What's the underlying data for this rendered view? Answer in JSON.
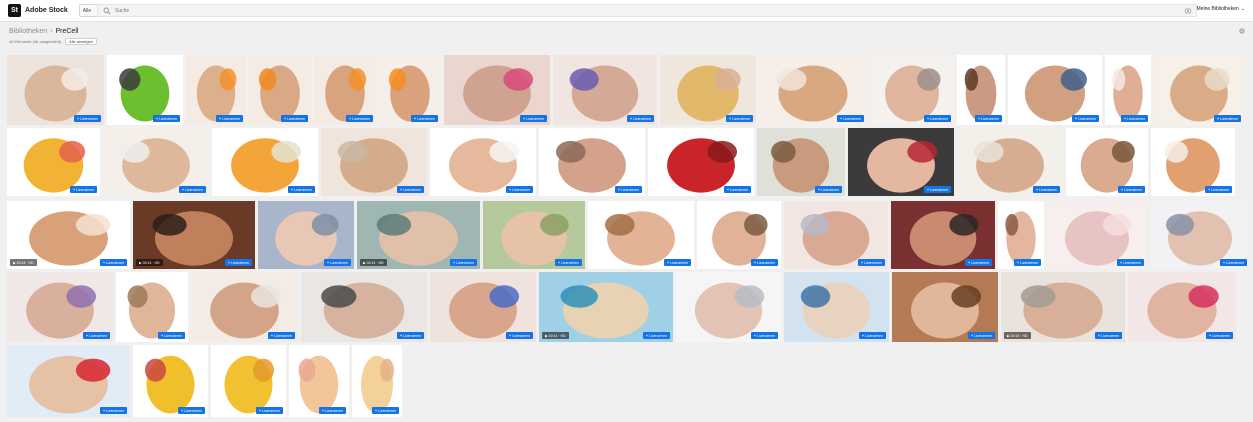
{
  "header": {
    "logo_mark": "St",
    "logo_text": "Adobe Stock",
    "category": "Alle",
    "search_placeholder": "Suche",
    "account_label": "Meine Bibliotheken"
  },
  "breadcrumb": {
    "library": "Bibliotheken",
    "separator": "›",
    "current": "PreCell"
  },
  "toolbar": {
    "count_label": "46 Elemente (46 ausgewählt)",
    "view_label": "Alle anzeigen"
  },
  "tile_button_label": "Lizenzieren",
  "video_badge": "▶ 00:14 · HD",
  "colors": {
    "accent": "#1473e6",
    "background": "#f0f0f0"
  },
  "tiles": [
    {
      "id": "hips-tape",
      "bg": "#ece4dc",
      "c1": "#d9b79a",
      "c2": "#f4ece6"
    },
    {
      "id": "apple-measure",
      "bg": "#ffffff",
      "c1": "#6cbf2f",
      "c2": "#3b3b3b"
    },
    {
      "id": "legs-orange",
      "bg": "#f3ebe4",
      "c1": "#dcb08d",
      "c2": "#f3902a"
    },
    {
      "id": "waist-orange",
      "bg": "#f3ebe4",
      "c1": "#d9a884",
      "c2": "#f08a22"
    },
    {
      "id": "hips-orange",
      "bg": "#f3ebe4",
      "c1": "#d8a47e",
      "c2": "#f29227"
    },
    {
      "id": "bikini-orange",
      "bg": "#f6efe9",
      "c1": "#d9a27c",
      "c2": "#f38d21"
    },
    {
      "id": "face-spa-gloves",
      "bg": "#ead5cf",
      "c1": "#cfa38f",
      "c2": "#d64a7a"
    },
    {
      "id": "face-device",
      "bg": "#f1e5e2",
      "c1": "#d4a995",
      "c2": "#6a5db0"
    },
    {
      "id": "gold-mask",
      "bg": "#efe7dd",
      "c1": "#e2b96a",
      "c2": "#d9b094"
    },
    {
      "id": "legs-shaving",
      "bg": "#f6eee8",
      "c1": "#d7a882",
      "c2": "#f1e5da"
    },
    {
      "id": "face-needle",
      "bg": "#f5f1ee",
      "c1": "#e0b59e",
      "c2": "#9a8f8a"
    },
    {
      "id": "woman-portrait",
      "bg": "#ffffff",
      "c1": "#cb9a82",
      "c2": "#5d3a25"
    },
    {
      "id": "jeans-waist",
      "bg": "#ffffff",
      "c1": "#d0a080",
      "c2": "#3f5f89"
    },
    {
      "id": "leg-raised",
      "bg": "#ffffff",
      "c1": "#dfae93",
      "c2": "#f4e8e4"
    },
    {
      "id": "legs-lying",
      "bg": "#f7f0e8",
      "c1": "#d9ab87",
      "c2": "#e9dbc8"
    },
    {
      "id": "cellulite-diagram",
      "bg": "#ffffff",
      "c1": "#f2b335",
      "c2": "#e3624a"
    },
    {
      "id": "legs-sheet",
      "bg": "#f5efe9",
      "c1": "#dfb89b",
      "c2": "#eeeeee"
    },
    {
      "id": "orange-measure",
      "bg": "#ffffff",
      "c1": "#f4a53a",
      "c2": "#e3e3d0"
    },
    {
      "id": "body-roller",
      "bg": "#efe5dc",
      "c1": "#d4ac8c",
      "c2": "#c8b7a2"
    },
    {
      "id": "women-row",
      "bg": "#ffffff",
      "c1": "#e6b89c",
      "c2": "#f4f4f4"
    },
    {
      "id": "face-laser",
      "bg": "#ffffff",
      "c1": "#d4a18a",
      "c2": "#8c6a56"
    },
    {
      "id": "red-apples",
      "bg": "#ffffff",
      "c1": "#c9242a",
      "c2": "#8b1a1a"
    },
    {
      "id": "aging-face",
      "bg": "#dfe0d8",
      "c1": "#c89a7e",
      "c2": "#7a5c3e"
    },
    {
      "id": "red-lips",
      "bg": "#3c3a3a",
      "c1": "#e4b7a0",
      "c2": "#b52834"
    },
    {
      "id": "spa-massage",
      "bg": "#f3efe9",
      "c1": "#d7ad92",
      "c2": "#e9e3d7"
    },
    {
      "id": "natural-beauty",
      "bg": "#ffffff",
      "c1": "#d9ab8f",
      "c2": "#7a5638"
    },
    {
      "id": "legs-crossed",
      "bg": "#ffffff",
      "c1": "#e0a070",
      "c2": "#f7efe6"
    },
    {
      "id": "legs-video",
      "bg": "#ffffff",
      "c1": "#d9a17a",
      "c2": "#f3e2d2"
    },
    {
      "id": "hot-stones",
      "bg": "#6a3a26",
      "c1": "#c0805c",
      "c2": "#2a1e1a"
    },
    {
      "id": "face-blue",
      "bg": "#a9b6c9",
      "c1": "#e8c7b4",
      "c2": "#7d8fa8"
    },
    {
      "id": "facial-treatment",
      "bg": "#9fb6b3",
      "c1": "#e0c0a8",
      "c2": "#5b7c78"
    },
    {
      "id": "face-roller-green",
      "bg": "#b6c99c",
      "c1": "#e6c2a6",
      "c2": "#8aa064"
    },
    {
      "id": "smiling-woman",
      "bg": "#ffffff",
      "c1": "#e2b394",
      "c2": "#a36d47"
    },
    {
      "id": "mature-woman",
      "bg": "#ffffff",
      "c1": "#e0b297",
      "c2": "#7a5b43"
    },
    {
      "id": "massage-hands",
      "bg": "#f1e6e2",
      "c1": "#d8aa94",
      "c2": "#b9b9c7"
    },
    {
      "id": "stone-spa",
      "bg": "#7a2f30",
      "c1": "#c98a70",
      "c2": "#2a2426"
    },
    {
      "id": "face-touch",
      "bg": "#ffffff",
      "c1": "#e4b6a0",
      "c2": "#8a5a40"
    },
    {
      "id": "text-overlay",
      "bg": "#f7efee",
      "c1": "#e7c3c3",
      "c2": "#f4dede"
    },
    {
      "id": "laser-face",
      "bg": "#f2f2f4",
      "c1": "#e3c1b0",
      "c2": "#8792a6"
    },
    {
      "id": "device-purple",
      "bg": "#f0e8e6",
      "c1": "#d8b09b",
      "c2": "#9070b0"
    },
    {
      "id": "portrait-woman",
      "bg": "#ffffff",
      "c1": "#dfb699",
      "c2": "#9c7a58"
    },
    {
      "id": "man-mask",
      "bg": "#f2ebe6",
      "c1": "#d3a487",
      "c2": "#e9e4e0"
    },
    {
      "id": "ultrasound-spa",
      "bg": "#e9e6e3",
      "c1": "#d6b39e",
      "c2": "#4a4a4a"
    },
    {
      "id": "face-gloves-blue",
      "bg": "#f0e2dc",
      "c1": "#d8a68c",
      "c2": "#4a6ac8"
    },
    {
      "id": "beach-legs",
      "bg": "#9fd0e6",
      "c1": "#e7d3b3",
      "c2": "#2f8fb9"
    },
    {
      "id": "laser-white",
      "bg": "#f5f5f6",
      "c1": "#e2c3b4",
      "c2": "#b8bcc7"
    },
    {
      "id": "face-mask-blue",
      "bg": "#d2e2ef",
      "c1": "#e8d2c0",
      "c2": "#3e74a8"
    },
    {
      "id": "massage-oil",
      "bg": "#b37a55",
      "c1": "#e1b699",
      "c2": "#6a3e22"
    },
    {
      "id": "spa-roller",
      "bg": "#eae2dc",
      "c1": "#d8b09a",
      "c2": "#a39b93"
    },
    {
      "id": "red-gloves-face",
      "bg": "#f3e6e6",
      "c1": "#e0b4a0",
      "c2": "#d6305a"
    },
    {
      "id": "woman-red-top",
      "bg": "#e1ecf6",
      "c1": "#e5c1a6",
      "c2": "#d6262d"
    },
    {
      "id": "normal-skin",
      "bg": "#ffffff",
      "c1": "#f2bf2c",
      "c2": "#c9463d"
    },
    {
      "id": "cellulite-skin",
      "bg": "#ffffff",
      "c1": "#f1c132",
      "c2": "#e39a2a"
    },
    {
      "id": "normal-skin-layers",
      "bg": "#ffffff",
      "c1": "#f2c69a",
      "c2": "#e7a891"
    },
    {
      "id": "cellulite-layers",
      "bg": "#ffffff",
      "c1": "#f4d199",
      "c2": "#e6b186"
    }
  ]
}
